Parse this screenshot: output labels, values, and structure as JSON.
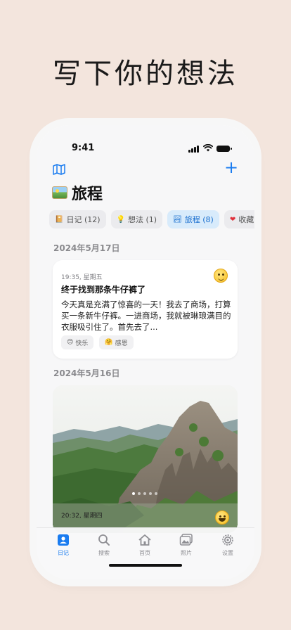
{
  "headline": "写下你的想法",
  "status_bar": {
    "time": "9:41"
  },
  "header": {
    "add_label": "+"
  },
  "page": {
    "title": "旅程"
  },
  "categories": [
    {
      "label": "日记 (12)",
      "icon": "notebook-icon",
      "active": false
    },
    {
      "label": "想法 (1)",
      "icon": "lightbulb-icon",
      "active": false
    },
    {
      "label": "旅程 (8)",
      "icon": "picture-icon",
      "active": true
    },
    {
      "label": "收藏",
      "icon": "heart-icon",
      "active": false
    }
  ],
  "groups": [
    {
      "date": "2024年5月17日",
      "entry": {
        "meta": "19:35, 星期五",
        "title": "终于找到那条牛仔裤了",
        "body": "今天真是充满了惊喜的一天！我去了商场，打算买一条新牛仔裤。一进商场，我就被琳琅满目的衣服吸引住了。首先去了...",
        "tags": [
          {
            "emoji": "😊",
            "label": "快乐"
          },
          {
            "emoji": "🤗",
            "label": "感恩"
          }
        ]
      }
    },
    {
      "date": "2024年5月16日",
      "entry": {
        "meta": "20:32, 星期四"
      }
    }
  ],
  "tabbar": [
    {
      "label": "日记",
      "icon": "journal-icon",
      "active": true
    },
    {
      "label": "搜索",
      "icon": "search-icon",
      "active": false
    },
    {
      "label": "首页",
      "icon": "home-icon",
      "active": false
    },
    {
      "label": "照片",
      "icon": "photos-icon",
      "active": false
    },
    {
      "label": "设置",
      "icon": "gear-icon",
      "active": false
    }
  ],
  "colors": {
    "accent": "#1a7cf0",
    "background": "#f3e5dd"
  }
}
